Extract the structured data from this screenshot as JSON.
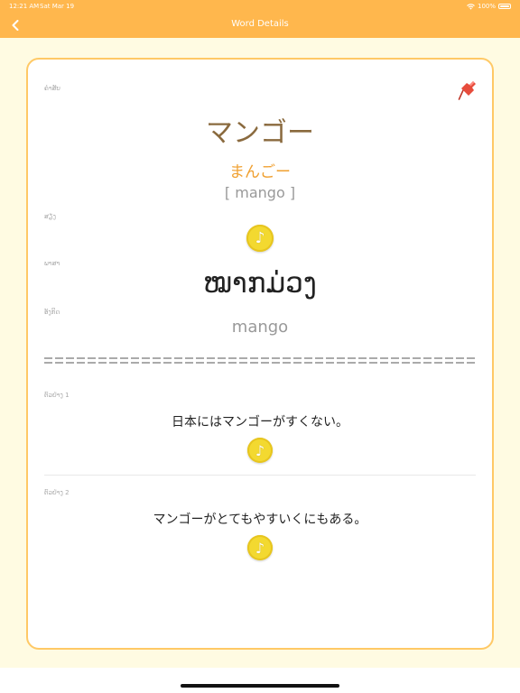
{
  "status": {
    "time": "12:21 AM",
    "date": "Sat Mar 19",
    "battery": "100%"
  },
  "nav": {
    "title": "Word Details",
    "back_icon": "chevron-left-icon"
  },
  "card": {
    "word_label": "ຄໍາສັບ",
    "word": "マンゴー",
    "kana": "まんごー",
    "romaji": "[ mango ]",
    "audio_label": "ສຽງ",
    "lao_label": "ພາສາ",
    "lao": "ໝາກມ່ວງ",
    "english_label": "ອັງກິດ",
    "english": "mango",
    "examples": [
      {
        "label": "ຕົວຢ່າງ 1",
        "sentence": "日本にはマンゴーがすくない。"
      },
      {
        "label": "ຕົວຢ່າງ 2",
        "sentence": "マンゴーがとてもやすいくにもある。"
      }
    ]
  },
  "colors": {
    "accent": "#ffb74d",
    "background": "#fffbe2",
    "card_border": "#ffc966",
    "sound_button": "#f3d930"
  }
}
